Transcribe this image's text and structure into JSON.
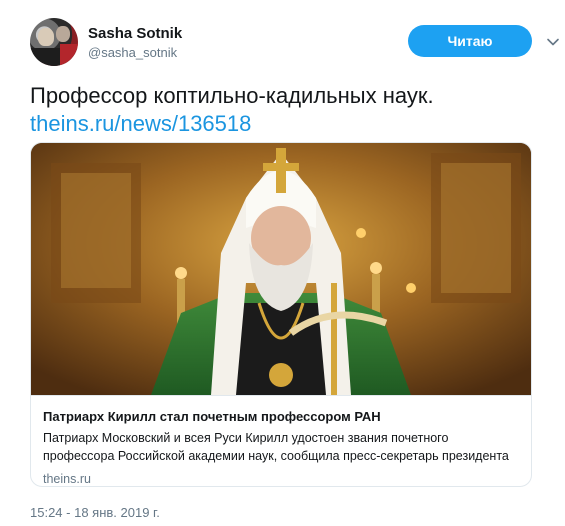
{
  "user": {
    "name": "Sasha Sotnik",
    "handle": "@sasha_sotnik"
  },
  "follow_button": {
    "label": "Читаю"
  },
  "tweet": {
    "text": "Профессор коптильно-кадильных наук.",
    "link": "theins.ru/news/136518"
  },
  "card": {
    "title": "Патриарх Кирилл стал почетным профессором РАН",
    "description": "Патриарх Московский и всея Руси Кирилл удостоен звания почетного профессора Российской академии наук, сообщила  пресс-секретарь президента",
    "domain": "theins.ru",
    "image_icon": "patriarch-photo"
  },
  "timestamp": "15:24 - 18 янв. 2019 г.",
  "icons": {
    "chevron": "chevron-down-icon"
  },
  "colors": {
    "accent": "#1da1f2",
    "link": "#1b95e0",
    "muted": "#657786",
    "border": "#e1e8ed"
  }
}
